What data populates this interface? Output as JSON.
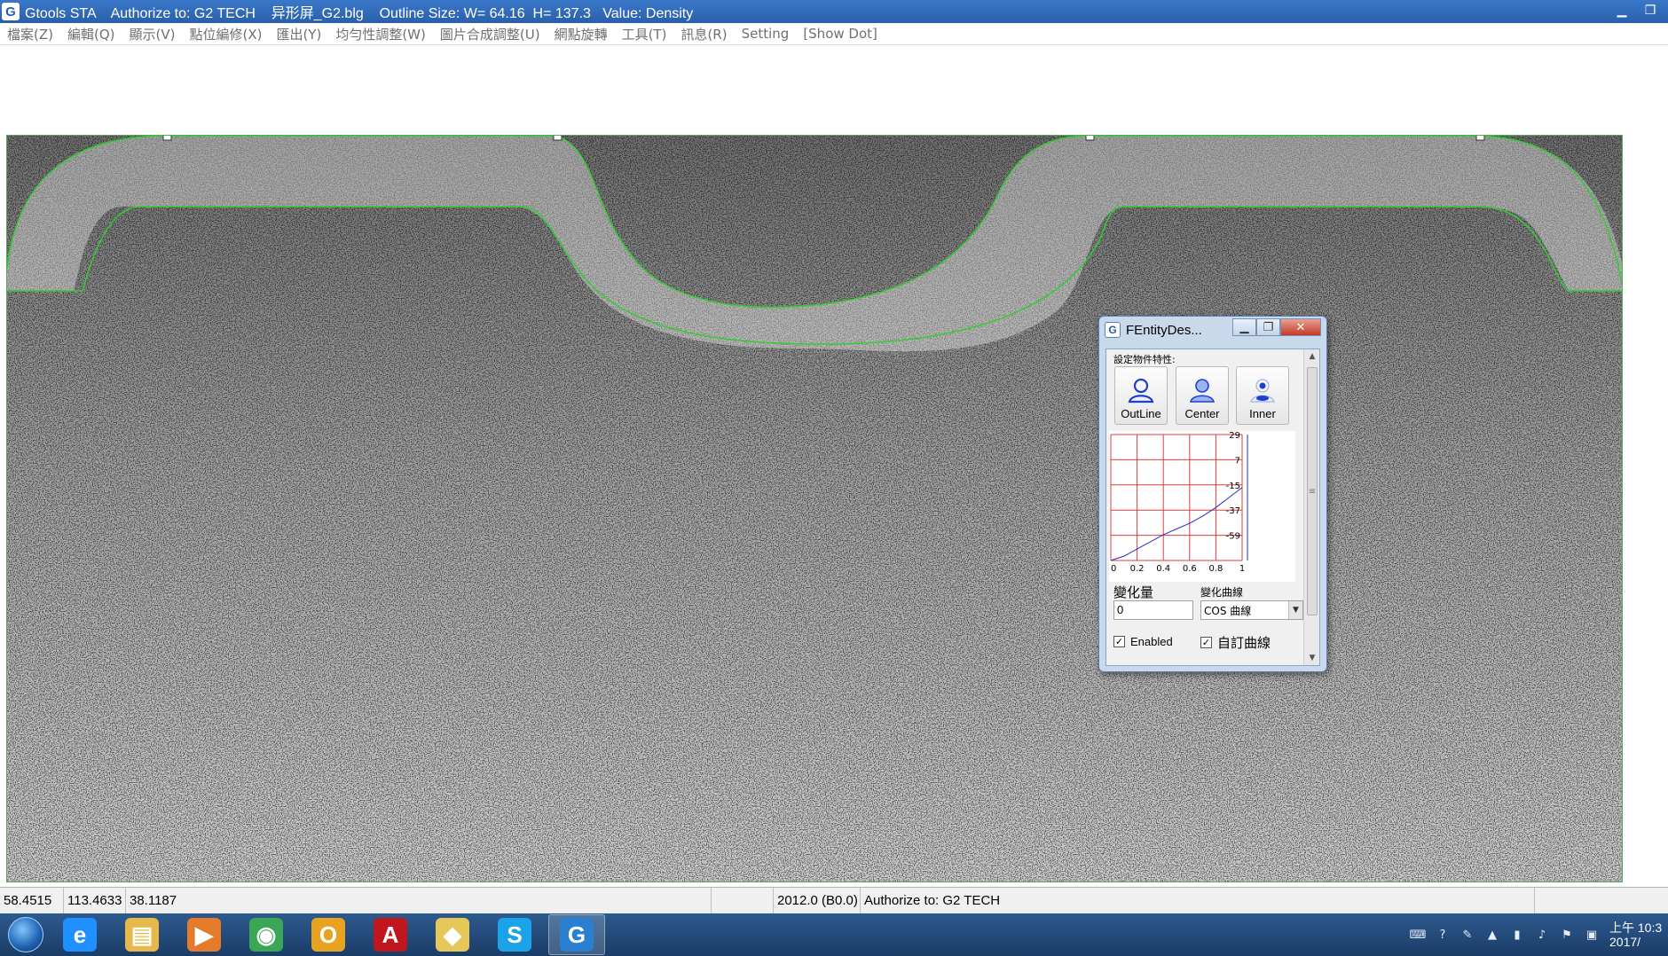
{
  "window": {
    "app_name": "Gtools STA",
    "title_text": "Gtools STA    Authorize to: G2 TECH    异形屏_G2.blg    Outline Size: W= 64.16  H= 137.3   Value: Density",
    "minimize_glyph": "▁",
    "maximize_glyph": "❐",
    "close_glyph": "✕"
  },
  "menu": {
    "items": [
      "檔案(Z)",
      "編輯(Q)",
      "顯示(V)",
      "點位編修(X)",
      "匯出(Y)",
      "均勻性調整(W)",
      "圖片合成調整(U)",
      "網點旋轉",
      "工具(T)",
      "訊息(R)",
      "Setting",
      "[Show Dot]"
    ]
  },
  "status_bar": {
    "x": "58.4515",
    "y": "113.4633",
    "z": "38.1187",
    "version": "2012.0 (B0.0)",
    "authorize": "Authorize to: G2 TECH"
  },
  "dialog": {
    "title": "FEntityDes...",
    "group_label": "設定物件特性:",
    "buttons": [
      {
        "label": "OutLine",
        "icon": "outline-person-icon"
      },
      {
        "label": "Center",
        "icon": "center-person-icon"
      },
      {
        "label": "Inner",
        "icon": "inner-person-icon"
      }
    ],
    "change_label": "變化量",
    "change_value": "0",
    "curve_label": "變化曲線",
    "curve_value": "COS 曲線",
    "enabled_label": "Enabled",
    "custom_curve_label": "自訂曲線",
    "enabled_checked": true,
    "custom_curve_checked": true,
    "check_glyph": "✓"
  },
  "taskbar": {
    "apps": [
      {
        "name": "internet-explorer-icon",
        "glyph": "e",
        "color": "#1e90ff"
      },
      {
        "name": "file-explorer-icon",
        "glyph": "▤",
        "color": "#e8b84a"
      },
      {
        "name": "media-player-icon",
        "glyph": "▶",
        "color": "#e57b2a"
      },
      {
        "name": "chrome-icon",
        "glyph": "◉",
        "color": "#3aa757"
      },
      {
        "name": "outlook-icon",
        "glyph": "O",
        "color": "#e8a321"
      },
      {
        "name": "acrobat-icon",
        "glyph": "A",
        "color": "#c0161d"
      },
      {
        "name": "folder-icon",
        "glyph": "◆",
        "color": "#e6c75a"
      },
      {
        "name": "skype-icon",
        "glyph": "S",
        "color": "#1aa3e8"
      },
      {
        "name": "gtools-icon",
        "glyph": "G",
        "color": "#2a7fd0"
      }
    ],
    "clock_line1": "上午 10:3",
    "clock_line2": "2017/"
  },
  "chart_data": {
    "type": "line",
    "x_ticks": [
      "0",
      "0.2",
      "0.4",
      "0.6",
      "0.8",
      "1"
    ],
    "y_ticks": [
      "29",
      "7",
      "-15",
      "-37",
      "-59"
    ],
    "xlim": [
      0,
      1
    ],
    "ylim": [
      -59,
      29
    ],
    "grid": true,
    "series": [
      {
        "x": [
          0,
          0.1,
          0.2,
          0.3,
          0.4,
          0.5,
          0.6,
          0.7,
          0.8,
          0.9,
          1.0
        ],
        "y": [
          -59,
          -56,
          -51,
          -46,
          -41,
          -37,
          -33,
          -28,
          -22,
          -15,
          -8
        ],
        "color": "#2030d0"
      }
    ]
  }
}
